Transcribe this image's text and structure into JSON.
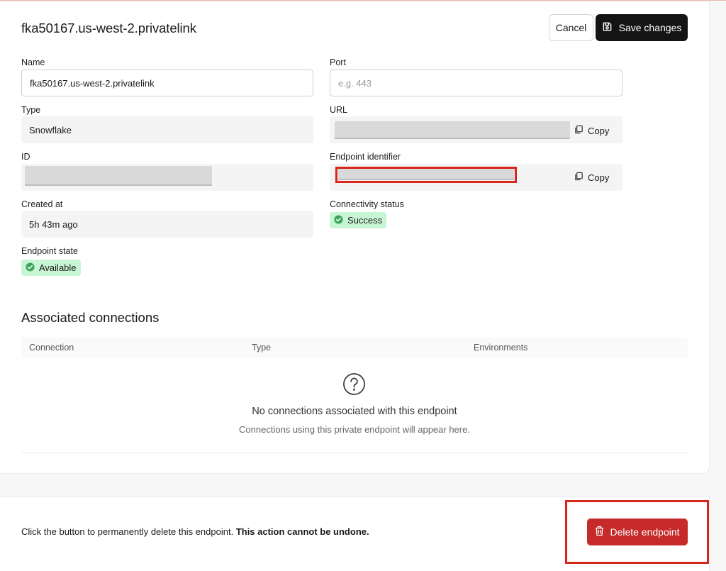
{
  "header": {
    "title": "fka50167.us-west-2.privatelink",
    "cancel_label": "Cancel",
    "save_label": "Save changes"
  },
  "form": {
    "name": {
      "label": "Name",
      "value": "fka50167.us-west-2.privatelink"
    },
    "port": {
      "label": "Port",
      "value": "",
      "placeholder": "e.g. 443"
    },
    "type": {
      "label": "Type",
      "value": "Snowflake"
    },
    "url": {
      "label": "URL",
      "copy_label": "Copy"
    },
    "id": {
      "label": "ID"
    },
    "endpoint_identifier": {
      "label": "Endpoint identifier",
      "copy_label": "Copy"
    },
    "created_at": {
      "label": "Created at",
      "value": "5h 43m ago"
    },
    "connectivity_status": {
      "label": "Connectivity status",
      "value": "Success"
    },
    "endpoint_state": {
      "label": "Endpoint state",
      "value": "Available"
    }
  },
  "connections": {
    "title": "Associated connections",
    "columns": [
      "Connection",
      "Type",
      "Environments"
    ],
    "empty_title": "No connections associated with this endpoint",
    "empty_subtitle": "Connections using this private endpoint will appear here."
  },
  "danger": {
    "text": "Click the button to permanently delete this endpoint.",
    "text_bold": "This action cannot be undone.",
    "delete_label": "Delete endpoint"
  },
  "colors": {
    "primary_button": "#141414",
    "success_badge": "#c8f5d3",
    "success_icon": "#3aa65a",
    "danger": "#c62a2a",
    "annotation": "#d7261a"
  },
  "icons": {
    "save": "save-icon",
    "copy": "copy-icon",
    "check": "check-circle-icon",
    "empty": "question-circle-icon",
    "delete": "trash-icon"
  }
}
